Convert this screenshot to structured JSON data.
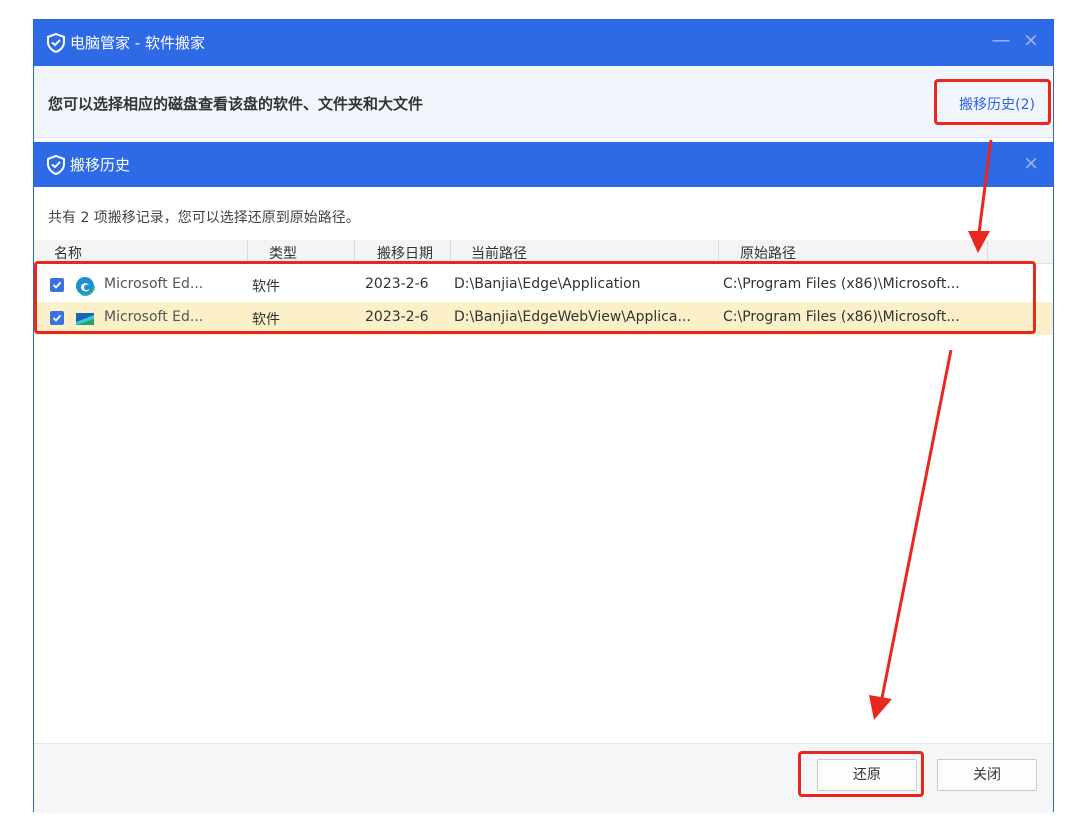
{
  "window": {
    "title": "电脑管家 - 软件搬家",
    "minimize_label": "—",
    "close_label": "×"
  },
  "infobar": {
    "text": "您可以选择相应的磁盘查看该盘的软件、文件夹和大文件",
    "history_link": "搬移历史(2)"
  },
  "dialog": {
    "title": "搬移历史",
    "close_label": "×",
    "summary": "共有 2 项搬移记录，您可以选择还原到原始路径。",
    "columns": [
      "名称",
      "类型",
      "搬移日期",
      "当前路径",
      "原始路径"
    ],
    "rows": [
      {
        "checked": true,
        "icon": "edge-icon",
        "name": "Microsoft Ed...",
        "type": "软件",
        "date": "2023-2-6",
        "current_path": "D:\\Banjia\\Edge\\Application",
        "original_path": "C:\\Program Files (x86)\\Microsoft..."
      },
      {
        "checked": true,
        "icon": "edge-webview-icon",
        "name": "Microsoft Ed...",
        "type": "软件",
        "date": "2023-2-6",
        "current_path": "D:\\Banjia\\EdgeWebView\\Applica...",
        "original_path": "C:\\Program Files (x86)\\Microsoft..."
      }
    ],
    "buttons": {
      "restore": "还原",
      "close": "关闭"
    }
  },
  "colors": {
    "title_bar": "#2f6ae6",
    "link": "#2f62e0",
    "selected_row": "#fbf0c8",
    "annotation": "#e8281f"
  }
}
